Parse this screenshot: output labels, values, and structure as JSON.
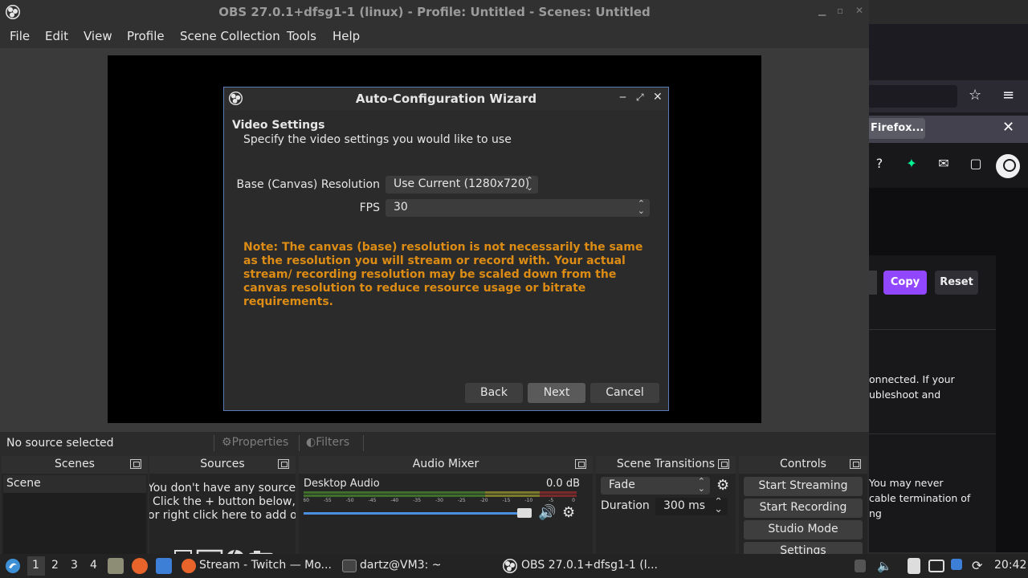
{
  "obs": {
    "title": "OBS 27.0.1+dfsg1-1 (linux) - Profile: Untitled - Scenes: Untitled",
    "menu": [
      "File",
      "Edit",
      "View",
      "Profile",
      "Scene Collection",
      "Tools",
      "Help"
    ],
    "source_bar": {
      "none": "No source selected",
      "properties": "Properties",
      "filters": "Filters"
    },
    "docks": {
      "scenes": {
        "title": "Scenes",
        "items": [
          "Scene"
        ]
      },
      "sources": {
        "title": "Sources",
        "message": [
          "You don't have any sources.",
          "Click the + button below,",
          "or right click here to add one."
        ]
      },
      "mixer": {
        "title": "Audio Mixer",
        "track": "Desktop Audio",
        "level": "0.0 dB",
        "ticks": [
          "-60",
          "-55",
          "-50",
          "-45",
          "-40",
          "-35",
          "-30",
          "-25",
          "-20",
          "-15",
          "-10",
          "-5",
          "0"
        ],
        "volume": 1.0
      },
      "transitions": {
        "title": "Scene Transitions",
        "type": "Fade",
        "duration_label": "Duration",
        "duration": "300 ms"
      },
      "controls": {
        "title": "Controls",
        "buttons": [
          "Start Streaming",
          "Start Recording",
          "Studio Mode",
          "Settings"
        ]
      }
    }
  },
  "dialog": {
    "title": "Auto-Configuration Wizard",
    "heading": "Video Settings",
    "subheading": "Specify the video settings you would like to use",
    "resolution_label": "Base (Canvas) Resolution",
    "resolution_value": "Use Current (1280x720)",
    "fps_label": "FPS",
    "fps_value": "30",
    "note": "Note: The canvas (base) resolution is not necessarily the same as the resolution you will stream or record with. Your actual stream/ recording resolution may be scaled down from the canvas resolution to reduce resource usage or bitrate requirements.",
    "back": "Back",
    "next": "Next",
    "cancel": "Cancel"
  },
  "firefox": {
    "tab": "Firefox...",
    "copy": "Copy",
    "reset": "Reset",
    "text1": [
      "onnected. If your",
      "ubleshoot and"
    ],
    "text2": [
      "You may never",
      "cable termination of",
      "ng"
    ]
  },
  "taskbar": {
    "workspaces": [
      "1",
      "2",
      "3",
      "4"
    ],
    "tasks": [
      "Stream - Twitch — Mo...",
      "dartz@VM3: ~",
      "OBS 27.0.1+dfsg1-1 (l..."
    ],
    "clock": "20:42"
  },
  "colors": {
    "accent_twitch": "#9147ff",
    "note": "#dc8c14",
    "dialog_border": "#5a7bb5"
  }
}
